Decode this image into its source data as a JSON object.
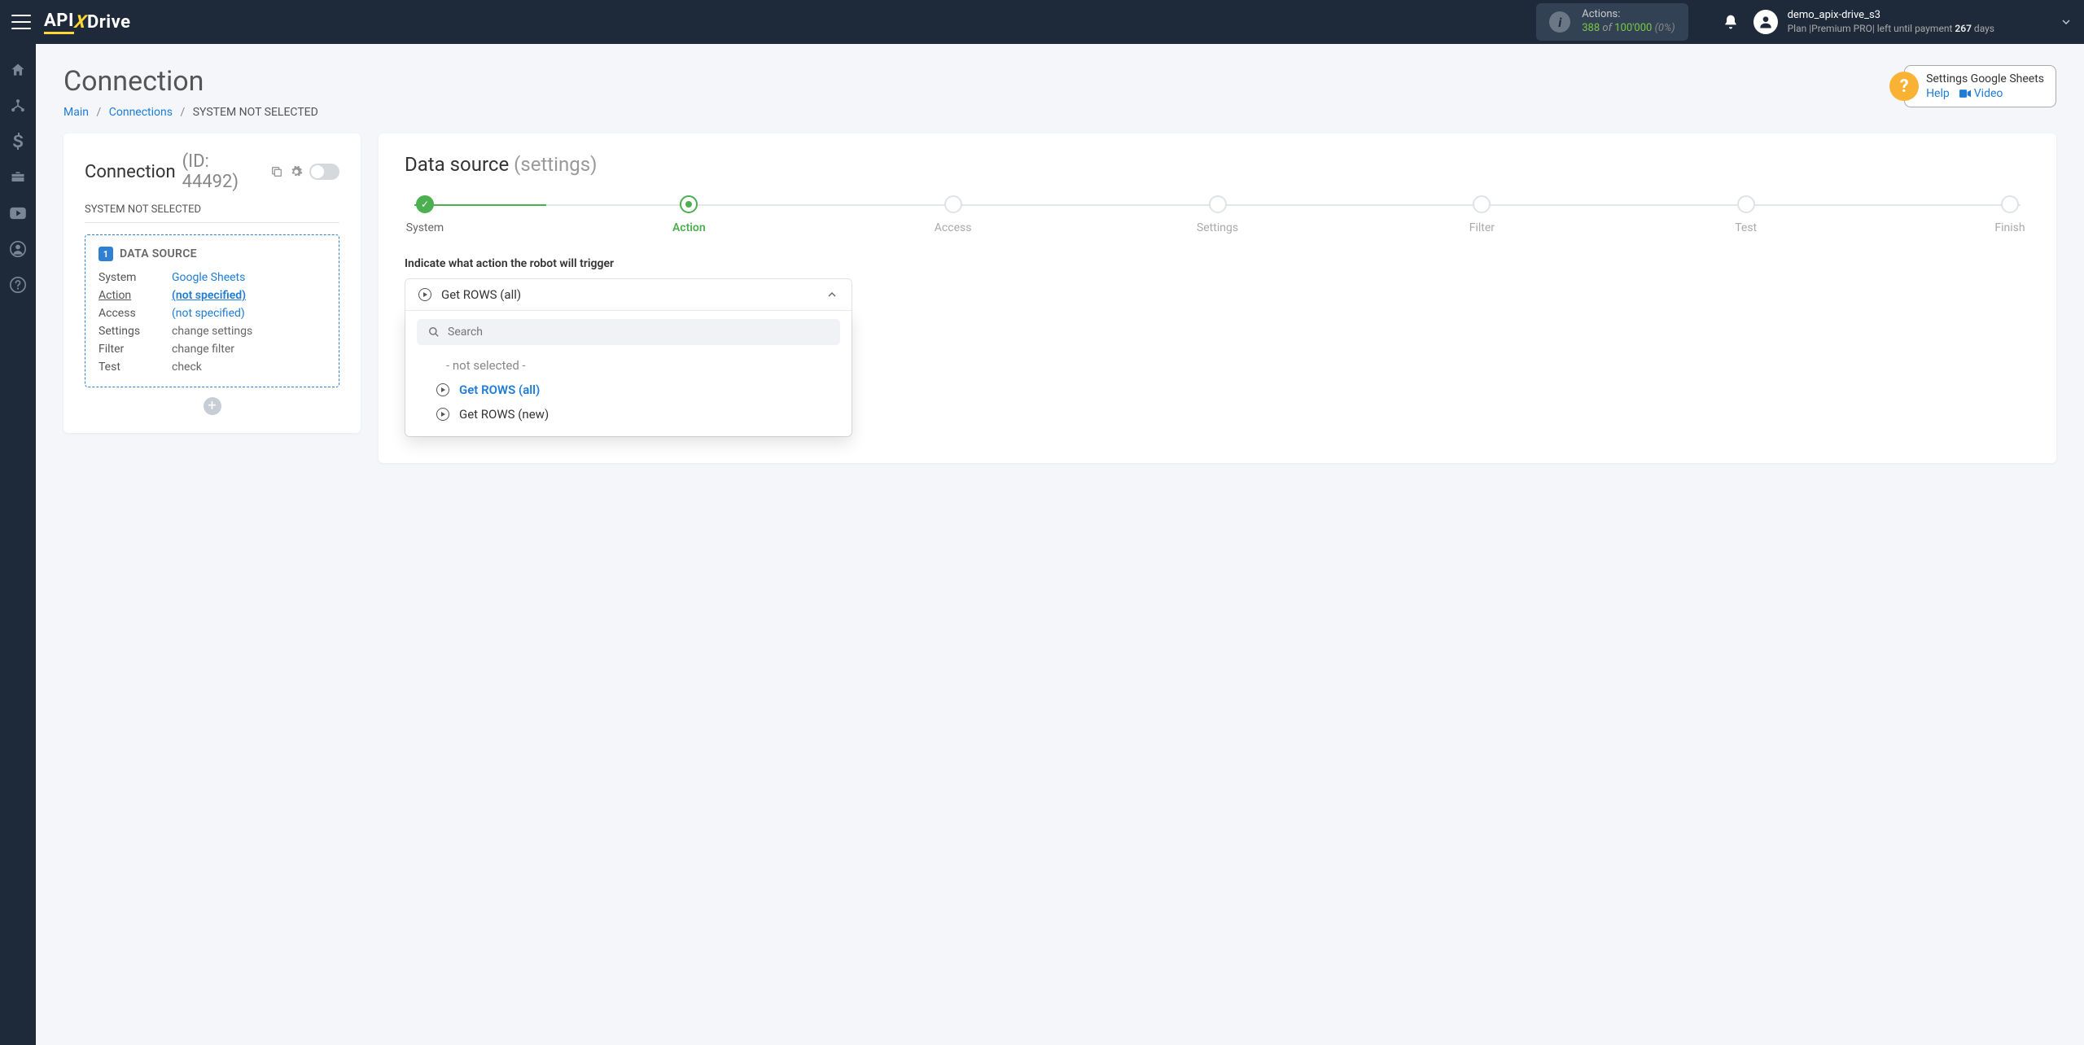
{
  "brand": {
    "p1": "API",
    "p2": "X",
    "p3": "Drive"
  },
  "header": {
    "actions_label": "Actions:",
    "actions_used": "388",
    "actions_of": "of",
    "actions_total": "100'000",
    "actions_pct": "(0%)",
    "username": "demo_apix-drive_s3",
    "plan_prefix": "Plan |",
    "plan_name": "Premium PRO",
    "plan_mid": "| left until payment",
    "plan_days_num": "267",
    "plan_days_word": "days"
  },
  "page": {
    "title": "Connection",
    "breadcrumb": {
      "main": "Main",
      "connections": "Connections",
      "current": "SYSTEM NOT SELECTED"
    }
  },
  "help": {
    "title": "Settings Google Sheets",
    "help_link": "Help",
    "video_link": "Video"
  },
  "conn_panel": {
    "title": "Connection",
    "id_text": "(ID: 44492)",
    "subtitle": "SYSTEM NOT SELECTED",
    "section_num": "1",
    "section_title": "DATA SOURCE",
    "rows": {
      "system": {
        "k": "System",
        "v": "Google Sheets"
      },
      "action": {
        "k": "Action",
        "v": "(not specified)"
      },
      "access": {
        "k": "Access",
        "v": "(not specified)"
      },
      "settings": {
        "k": "Settings",
        "v": "change settings"
      },
      "filter": {
        "k": "Filter",
        "v": "change filter"
      },
      "test": {
        "k": "Test",
        "v": "check"
      }
    }
  },
  "mainpanel": {
    "title": "Data source",
    "subtitle": "(settings)",
    "steps": [
      "System",
      "Action",
      "Access",
      "Settings",
      "Filter",
      "Test",
      "Finish"
    ],
    "form_label": "Indicate what action the robot will trigger",
    "dropdown": {
      "selected": "Get ROWS (all)",
      "search_placeholder": "Search",
      "opt_placeholder": "- not selected -",
      "opt1": "Get ROWS (all)",
      "opt2": "Get ROWS (new)"
    }
  }
}
